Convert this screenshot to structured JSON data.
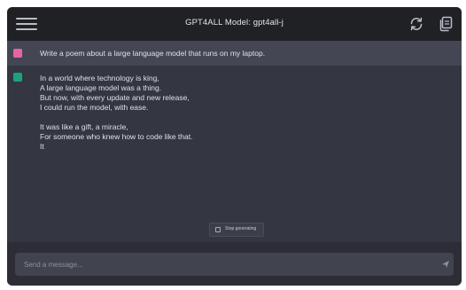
{
  "header": {
    "title": "GPT4ALL Model: gpt4all-j",
    "menu_icon": "hamburger-menu-icon",
    "refresh_icon": "refresh-icon",
    "copy_icon": "copy-icon"
  },
  "prompt": {
    "avatar_color": "#e864a7",
    "text": "Write a poem about a large language model that runs on my laptop."
  },
  "response": {
    "avatar_color": "#1aa37a",
    "stanza1": [
      "In a world where technology is king,",
      "A large language model was a thing.",
      "But now, with every update and new release,",
      "I could run the model, with ease."
    ],
    "stanza2": [
      "It was like a gift, a miracle,",
      "For someone who knew how to code like that.",
      "It"
    ]
  },
  "stop_button": {
    "label": "Stop generating",
    "icon": "stop-square-icon"
  },
  "input": {
    "placeholder": "Send a message...",
    "value": "",
    "send_icon": "send-icon"
  },
  "colors": {
    "header_bg": "#202124",
    "chat_bg": "#343642",
    "prompt_bg": "#444654",
    "input_area_bg": "#2c2d36"
  }
}
